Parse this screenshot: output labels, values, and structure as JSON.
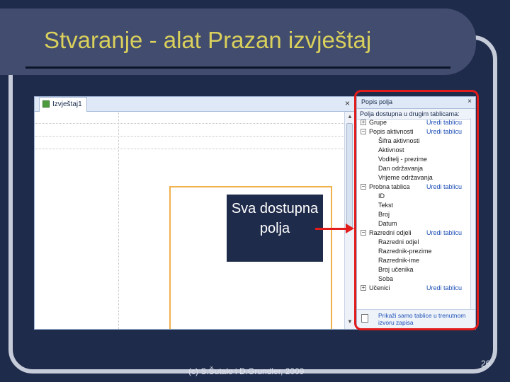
{
  "slide": {
    "title": "Stvaranje - alat Prazan izvještaj",
    "footer": "(c) S.Šutalo i D.Grundler, 2009",
    "page_number": "26",
    "callout_text": "Sva dostupna polja"
  },
  "report_tab": {
    "label": "Izvještaj1",
    "close": "×"
  },
  "pane": {
    "title": "Popis polja",
    "close": "×",
    "subtitle": "Polja dostupna u drugim tablicama:",
    "tables": [
      {
        "toggle": "+",
        "name": "Grupe",
        "link": "Uredi tablicu",
        "fields": []
      },
      {
        "toggle": "−",
        "name": "Popis aktivnosti",
        "link": "Uredi tablicu",
        "fields": [
          "Šifra aktivnosti",
          "Aktivnost",
          "Voditelj - prezime",
          "Dan održavanja",
          "Vrijeme održavanja"
        ]
      },
      {
        "toggle": "−",
        "name": "Probna tablica",
        "link": "Uredi tablicu",
        "fields": [
          "ID",
          "Tekst",
          "Broj",
          "Datum"
        ]
      },
      {
        "toggle": "−",
        "name": "Razredni odjeli",
        "link": "Uredi tablicu",
        "fields": [
          "Razredni odjel",
          "Razrednik-prezime",
          "Razrednik-ime",
          "Broj učenika",
          "Soba"
        ]
      },
      {
        "toggle": "+",
        "name": "Učenici",
        "link": "Uredi tablicu",
        "fields": []
      }
    ],
    "footer_link": "Prikaži samo tablice u trenutnom izvoru zapisa"
  },
  "colors": {
    "background": "#1f2b4a",
    "title": "#dad05c",
    "highlight": "#e21b1b",
    "report_border": "#f0b14c",
    "link": "#1d4fb5"
  }
}
